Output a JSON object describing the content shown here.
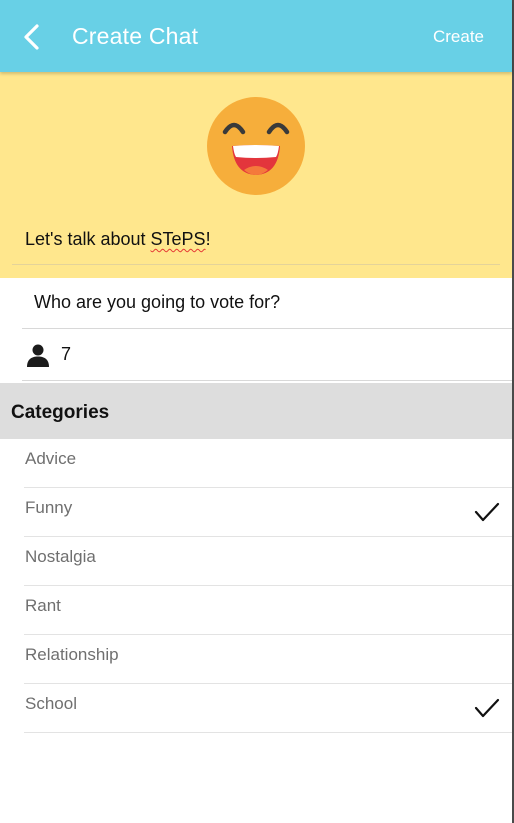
{
  "app_bar": {
    "title": "Create Chat",
    "create_label": "Create",
    "back_icon": "chevron-left-icon",
    "background": "#68d0e6"
  },
  "hero": {
    "background": "#ffe78d",
    "emoji_icon": "laughing-face-icon",
    "chat_name_prefix": "Let's talk about ",
    "chat_name_highlight": "STePS",
    "chat_name_suffix": "!"
  },
  "question": {
    "text": "Who are you going to vote for?"
  },
  "members": {
    "icon": "person-icon",
    "count": "7"
  },
  "categories": {
    "header": "Categories",
    "items": [
      {
        "label": "Advice",
        "checked": false
      },
      {
        "label": "Funny",
        "checked": true
      },
      {
        "label": "Nostalgia",
        "checked": false
      },
      {
        "label": "Rant",
        "checked": false
      },
      {
        "label": "Relationship",
        "checked": false
      },
      {
        "label": "School",
        "checked": true
      }
    ]
  }
}
